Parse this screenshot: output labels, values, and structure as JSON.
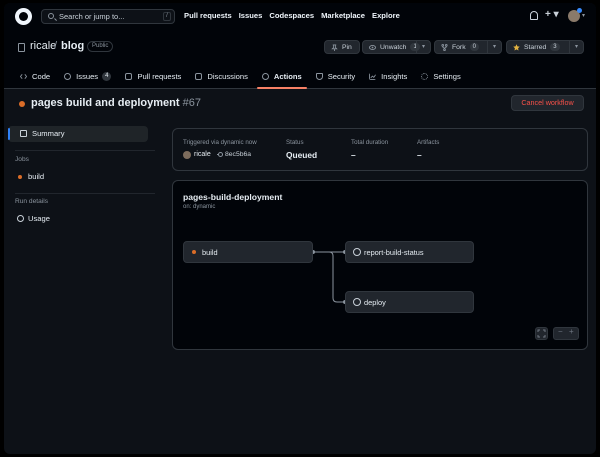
{
  "header": {
    "search_placeholder": "Search or jump to...",
    "search_kbd": "/",
    "nav": [
      "Pull requests",
      "Issues",
      "Codespaces",
      "Marketplace",
      "Explore"
    ],
    "plus": "+ ▾",
    "avatar_caret": "▾"
  },
  "repo": {
    "owner": "ricale",
    "slash": "/",
    "name": "blog",
    "visibility": "Public",
    "pin_label": "Pin",
    "unwatch_label": "Unwatch",
    "unwatch_count": "1",
    "fork_label": "Fork",
    "fork_count": "0",
    "starred_label": "Starred",
    "starred_count": "3",
    "dropdown_caret": "▾"
  },
  "tabs": [
    {
      "label": "Code"
    },
    {
      "label": "Issues",
      "count": "4"
    },
    {
      "label": "Pull requests"
    },
    {
      "label": "Discussions"
    },
    {
      "label": "Actions"
    },
    {
      "label": "Security"
    },
    {
      "label": "Insights"
    },
    {
      "label": "Settings"
    }
  ],
  "run": {
    "title": "pages build and deployment",
    "number": "#67",
    "cancel_label": "Cancel workflow",
    "status_color": "#db6d28"
  },
  "sidebar": {
    "summary_label": "Summary",
    "jobs_heading": "Jobs",
    "job_build": "build",
    "run_details_heading": "Run details",
    "usage_label": "Usage"
  },
  "summary": {
    "triggered_label": "Triggered via dynamic now",
    "user": "ricale",
    "commit": "8ec5b6a",
    "status_label": "Status",
    "status_value": "Queued",
    "duration_label": "Total duration",
    "duration_value": "–",
    "artifacts_label": "Artifacts",
    "artifacts_value": "–"
  },
  "workflow": {
    "name": "pages-build-deployment",
    "trigger": "on: dynamic",
    "jobs": {
      "build": "build",
      "report": "report-build-status",
      "deploy": "deploy"
    },
    "zoom_out": "−",
    "zoom_in": "+"
  }
}
